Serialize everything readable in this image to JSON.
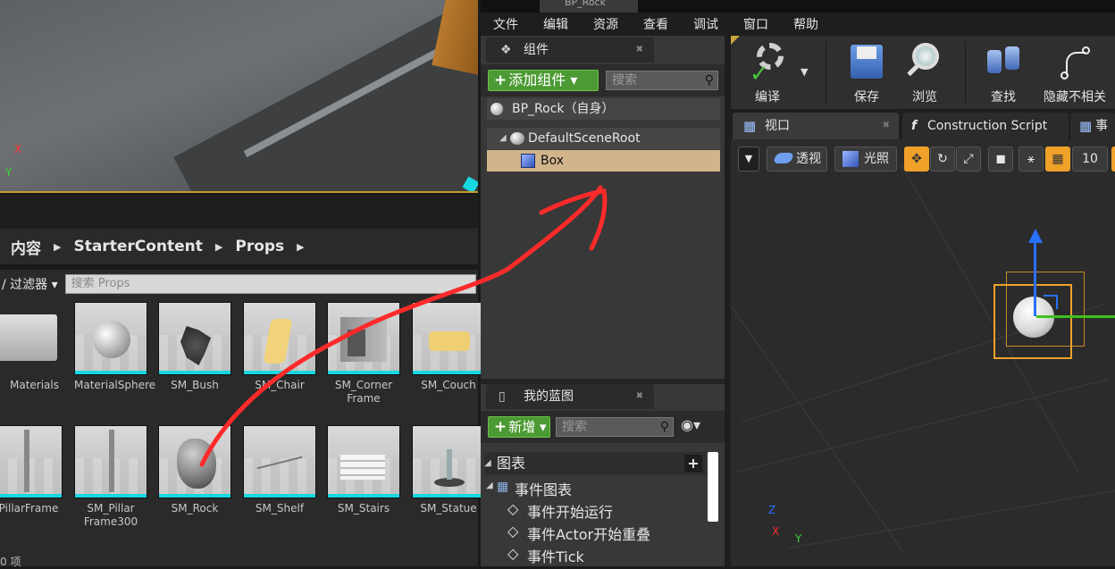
{
  "viewport_left": {
    "axis_x": "X",
    "axis_y": "Y"
  },
  "content_browser": {
    "breadcrumb": [
      "内容",
      "StarterContent",
      "Props"
    ],
    "filter_label": "过滤器",
    "search_placeholder": "搜索 Props",
    "assets_row1": [
      "Materials",
      "MaterialSphere",
      "SM_Bush",
      "SM_Chair",
      "SM_Corner Frame",
      "SM_Couch"
    ],
    "assets_row2": [
      "_PillarFrame",
      "SM_Pillar Frame300",
      "SM_Rock",
      "SM_Shelf",
      "SM_Stairs",
      "SM_Statue"
    ],
    "item_count": "0 项",
    "selection_color": "#17d7e0"
  },
  "window": {
    "tab_title": "BP_Rock"
  },
  "menubar": [
    "文件",
    "编辑",
    "资源",
    "查看",
    "调试",
    "窗口",
    "帮助"
  ],
  "components_panel": {
    "title": "组件",
    "add_button": "添加组件",
    "search_placeholder": "搜索",
    "self_label": "BP_Rock（自身）",
    "tree": [
      {
        "label": "DefaultSceneRoot",
        "icon": "scene-root-icon"
      },
      {
        "label": "Box",
        "icon": "box-icon",
        "selected": true
      }
    ],
    "selected_color": "#d2b48c"
  },
  "my_blueprint_panel": {
    "title": "我的蓝图",
    "new_button": "新增",
    "search_placeholder": "搜索",
    "section_graphs": "图表",
    "event_graph": "事件图表",
    "events": [
      "事件开始运行",
      "事件Actor开始重叠",
      "事件Tick"
    ]
  },
  "toolbar": {
    "compile": "编译",
    "save": "保存",
    "browse": "浏览",
    "find": "查找",
    "hide_unrelated": "隐藏不相关"
  },
  "viewport_tabs": {
    "viewport": "视口",
    "construction_script": "Construction Script",
    "event": "事"
  },
  "viewport_right": {
    "perspective": "透视",
    "lit": "光照",
    "grid_size": "10",
    "axis_x": "X",
    "axis_y": "Y",
    "axis_z": "Z"
  },
  "accent_colors": {
    "green": "#4c9a33",
    "orange": "#f0a12a",
    "annotation_red": "#ff2a2a"
  }
}
